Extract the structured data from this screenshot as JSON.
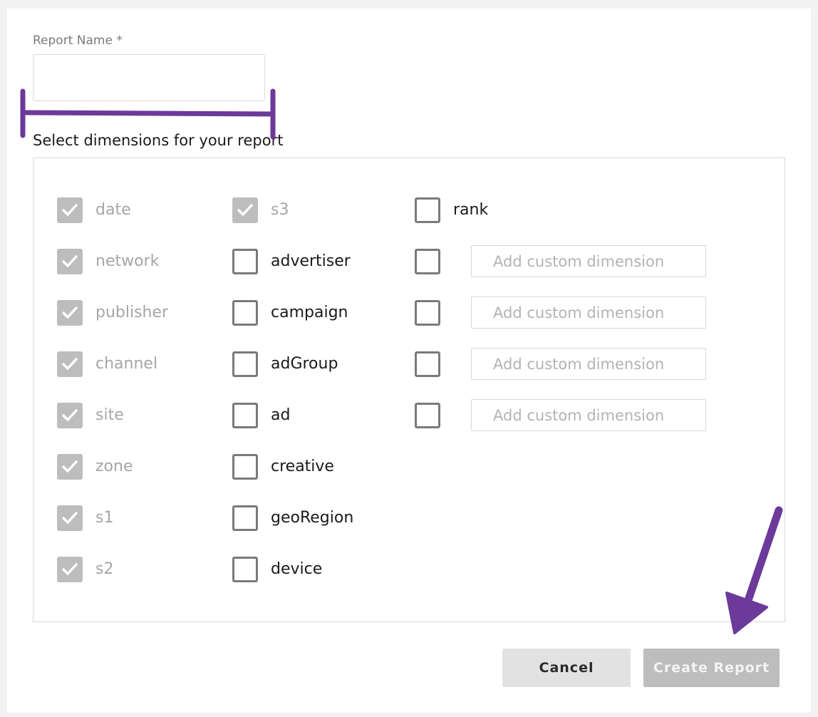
{
  "form": {
    "report_name_label": "Report Name *",
    "report_name_value": "",
    "dimensions_label": "Select dimensions for your report"
  },
  "dimensions": {
    "column1": [
      {
        "label": "date",
        "checked": true,
        "disabled": true
      },
      {
        "label": "network",
        "checked": true,
        "disabled": true
      },
      {
        "label": "publisher",
        "checked": true,
        "disabled": true
      },
      {
        "label": "channel",
        "checked": true,
        "disabled": true
      },
      {
        "label": "site",
        "checked": true,
        "disabled": true
      },
      {
        "label": "zone",
        "checked": true,
        "disabled": true
      },
      {
        "label": "s1",
        "checked": true,
        "disabled": true
      },
      {
        "label": "s2",
        "checked": true,
        "disabled": true
      }
    ],
    "column2": [
      {
        "label": "s3",
        "checked": true,
        "disabled": true
      },
      {
        "label": "advertiser",
        "checked": false,
        "disabled": false
      },
      {
        "label": "campaign",
        "checked": false,
        "disabled": false
      },
      {
        "label": "adGroup",
        "checked": false,
        "disabled": false
      },
      {
        "label": "ad",
        "checked": false,
        "disabled": false
      },
      {
        "label": "creative",
        "checked": false,
        "disabled": false
      },
      {
        "label": "geoRegion",
        "checked": false,
        "disabled": false
      },
      {
        "label": "device",
        "checked": false,
        "disabled": false
      }
    ],
    "column3": [
      {
        "label": "rank",
        "checked": false,
        "disabled": false
      }
    ],
    "custom": [
      {
        "placeholder": "Add custom dimension",
        "value": "",
        "checked": false
      },
      {
        "placeholder": "Add custom dimension",
        "value": "",
        "checked": false
      },
      {
        "placeholder": "Add custom dimension",
        "value": "",
        "checked": false
      },
      {
        "placeholder": "Add custom dimension",
        "value": "",
        "checked": false
      }
    ]
  },
  "actions": {
    "cancel_label": "Cancel",
    "create_label": "Create Report"
  },
  "colors": {
    "annotation": "#6b3a9a",
    "checkbox_checked": "#bdbdbd",
    "checkbox_border": "#7a7a7a"
  }
}
